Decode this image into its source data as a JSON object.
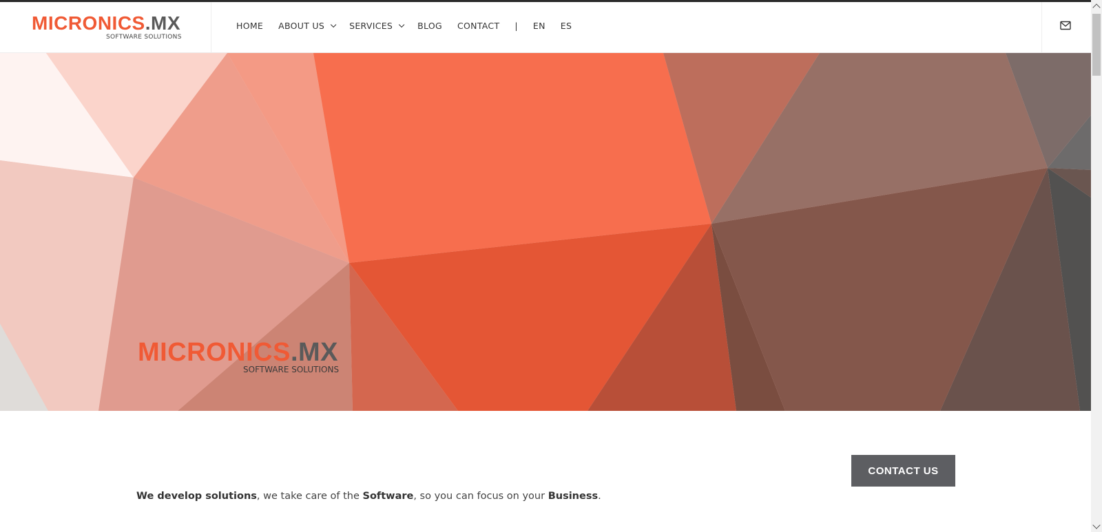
{
  "header": {
    "logo": {
      "brand": "MICRONICS",
      "suffix": ".MX",
      "tagline": "SOFTWARE SOLUTIONS"
    },
    "nav": [
      {
        "label": "HOME",
        "dropdown": false
      },
      {
        "label": "ABOUT US",
        "dropdown": true
      },
      {
        "label": "SERVICES",
        "dropdown": true
      },
      {
        "label": "BLOG",
        "dropdown": false
      },
      {
        "label": "CONTACT",
        "dropdown": false
      }
    ],
    "divider": "|",
    "languages": [
      "EN",
      "ES"
    ],
    "icon": "mail-icon"
  },
  "hero": {
    "logo": {
      "brand": "MICRONICS",
      "suffix": ".MX",
      "tagline": "SOFTWARE SOLUTIONS"
    }
  },
  "cta": {
    "label": "CONTACT US"
  },
  "tagline": {
    "p1": "We develop solutions",
    "p2": ", we take care of the ",
    "p3": "Software",
    "p4": ", so you can focus on your ",
    "p5": "Business",
    "p6": "."
  },
  "colors": {
    "brand": "#f05a35",
    "gray": "#5a5a5a",
    "button": "#5d5e62"
  }
}
